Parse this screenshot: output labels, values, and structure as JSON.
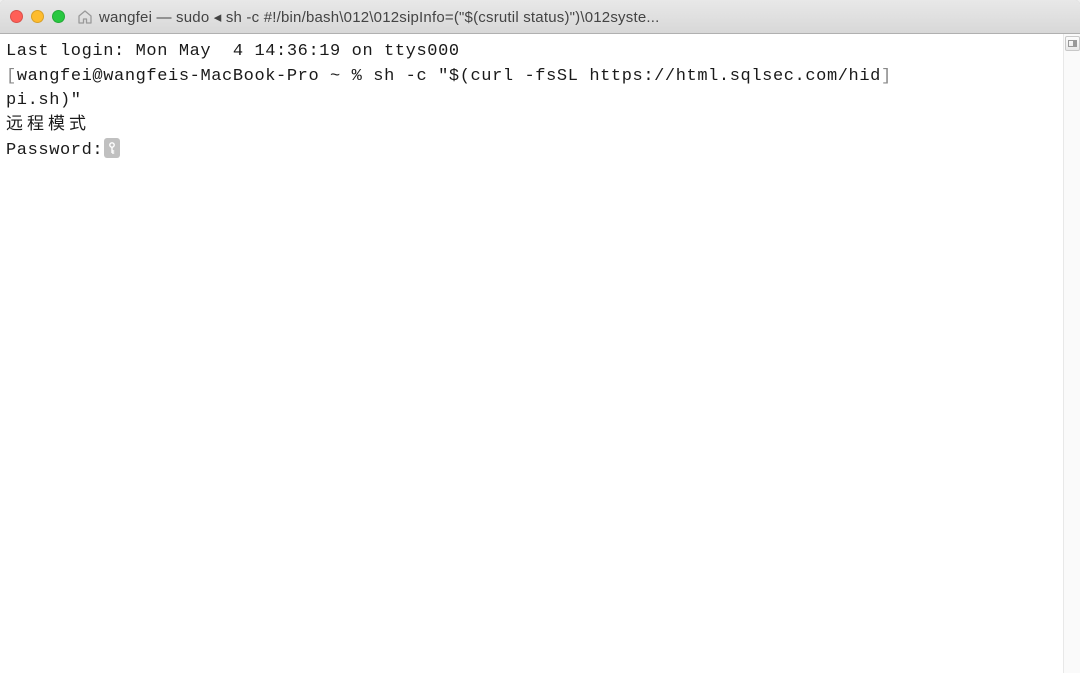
{
  "titlebar": {
    "title": "wangfei — sudo ◂ sh -c #!/bin/bash\\012\\012sipInfo=(\"$(csrutil status)\")\\012syste..."
  },
  "terminal": {
    "line1": "Last login: Mon May  4 14:36:19 on ttys000",
    "prompt_open": "[",
    "prompt_user": "wangfei@wangfeis-MacBook-Pro ~ % ",
    "command": "sh -c \"$(curl -fsSL https://html.sqlsec.com/hid",
    "prompt_close": "]",
    "line3": "pi.sh)\"",
    "line4_cjk": "远程模式",
    "password_label": "Password:"
  }
}
